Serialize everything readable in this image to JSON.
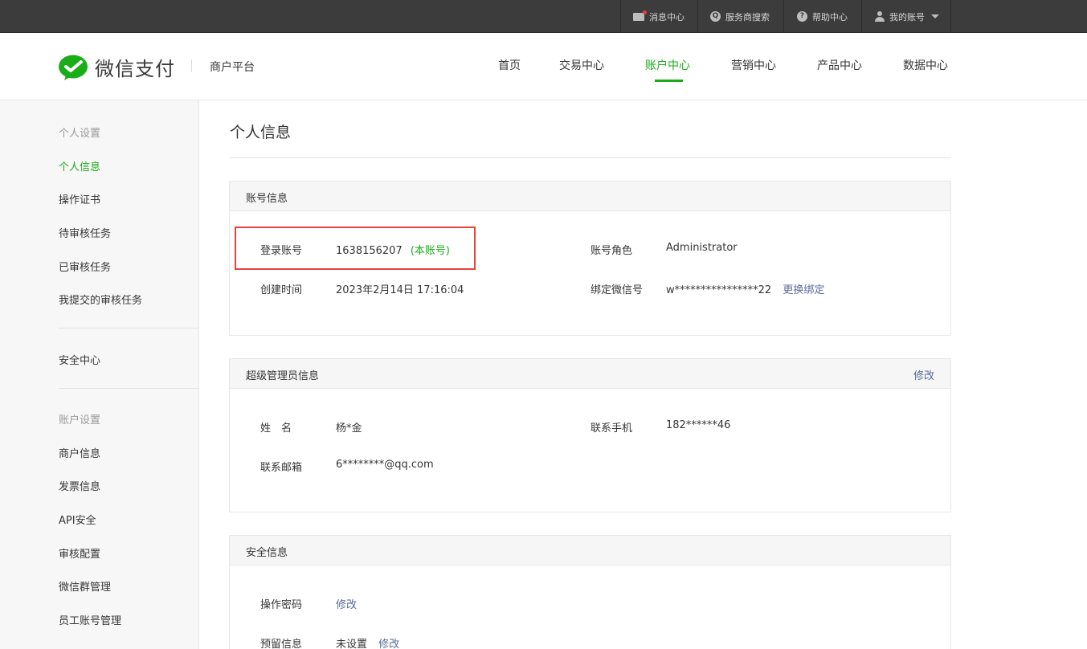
{
  "topbar": {
    "messages": "消息中心",
    "provider_search": "服务商搜索",
    "help": "帮助中心",
    "account": "我的账号"
  },
  "header": {
    "brand": "微信支付",
    "subtitle": "商户平台",
    "nav": [
      "首页",
      "交易中心",
      "账户中心",
      "营销中心",
      "产品中心",
      "数据中心"
    ],
    "active_nav": "账户中心"
  },
  "sidebar": {
    "group1": "个人设置",
    "items1": [
      "个人信息",
      "操作证书",
      "待审核任务",
      "已审核任务",
      "我提交的审核任务"
    ],
    "security": "安全中心",
    "group2": "账户设置",
    "items2": [
      "商户信息",
      "发票信息",
      "API安全",
      "审核配置",
      "微信群管理",
      "员工账号管理"
    ]
  },
  "main": {
    "title": "个人信息",
    "account_info": {
      "heading": "账号信息",
      "login_label": "登录账号",
      "login_value": "1638156207",
      "login_tag": "(本账号)",
      "role_label": "账号角色",
      "role_value": "Administrator",
      "created_label": "创建时间",
      "created_value": "2023年2月14日 17:16:04",
      "wechat_label": "绑定微信号",
      "wechat_value": "w****************22",
      "wechat_link": "更换绑定"
    },
    "admin_info": {
      "heading": "超级管理员信息",
      "edit": "修改",
      "name_label": "姓　名",
      "name_value": "杨*金",
      "phone_label": "联系手机",
      "phone_value": "182******46",
      "email_label": "联系邮箱",
      "email_value": "6********@qq.com"
    },
    "security_info": {
      "heading": "安全信息",
      "pwd_label": "操作密码",
      "pwd_link": "修改",
      "reserve_label": "预留信息",
      "reserve_value": "未设置",
      "reserve_link": "修改"
    }
  },
  "colors": {
    "accent": "#1aad19",
    "link": "#576b95",
    "highlight": "#e64340",
    "topbar": "#3c3c3c"
  }
}
